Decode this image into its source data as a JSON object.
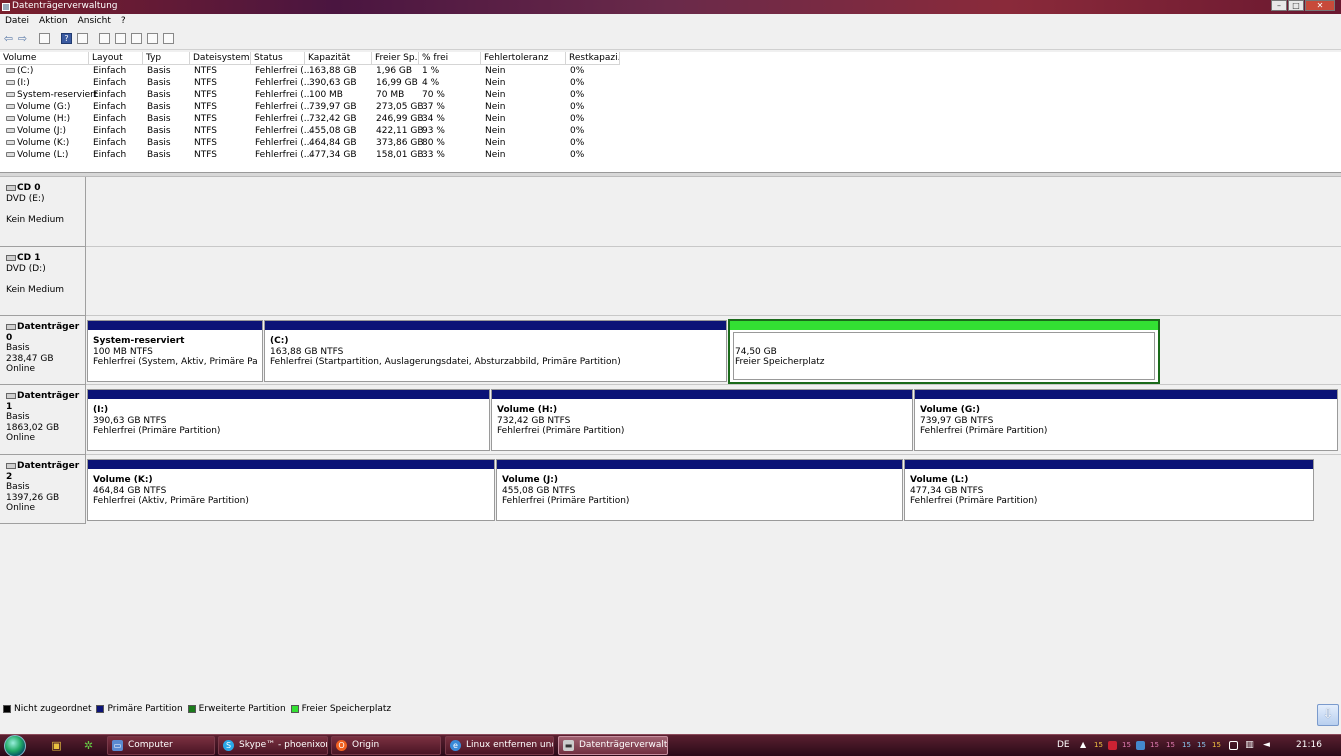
{
  "window": {
    "title": "Datenträgerverwaltung",
    "min_label": "–",
    "max_label": "□",
    "close_label": "✕"
  },
  "menu": [
    "Datei",
    "Aktion",
    "Ansicht",
    "?"
  ],
  "toolbar": {
    "back_label": "⇦",
    "forward_label": "⇨",
    "help_label": "?"
  },
  "volume_list": {
    "columns": [
      "Volume",
      "Layout",
      "Typ",
      "Dateisystem",
      "Status",
      "Kapazität",
      "Freier Sp...",
      "% frei",
      "Fehlertoleranz",
      "Restkapazi..."
    ],
    "rows": [
      [
        "(C:)",
        "Einfach",
        "Basis",
        "NTFS",
        "Fehlerfrei (...",
        "163,88 GB",
        "1,96 GB",
        "1 %",
        "Nein",
        "0%"
      ],
      [
        "(I:)",
        "Einfach",
        "Basis",
        "NTFS",
        "Fehlerfrei (...",
        "390,63 GB",
        "16,99 GB",
        "4 %",
        "Nein",
        "0%"
      ],
      [
        "System-reserviert",
        "Einfach",
        "Basis",
        "NTFS",
        "Fehlerfrei (...",
        "100 MB",
        "70 MB",
        "70 %",
        "Nein",
        "0%"
      ],
      [
        "Volume (G:)",
        "Einfach",
        "Basis",
        "NTFS",
        "Fehlerfrei (...",
        "739,97 GB",
        "273,05 GB",
        "37 %",
        "Nein",
        "0%"
      ],
      [
        "Volume (H:)",
        "Einfach",
        "Basis",
        "NTFS",
        "Fehlerfrei (...",
        "732,42 GB",
        "246,99 GB",
        "34 %",
        "Nein",
        "0%"
      ],
      [
        "Volume (J:)",
        "Einfach",
        "Basis",
        "NTFS",
        "Fehlerfrei (...",
        "455,08 GB",
        "422,11 GB",
        "93 %",
        "Nein",
        "0%"
      ],
      [
        "Volume (K:)",
        "Einfach",
        "Basis",
        "NTFS",
        "Fehlerfrei (...",
        "464,84 GB",
        "373,86 GB",
        "80 %",
        "Nein",
        "0%"
      ],
      [
        "Volume (L:)",
        "Einfach",
        "Basis",
        "NTFS",
        "Fehlerfrei (...",
        "477,34 GB",
        "158,01 GB",
        "33 %",
        "Nein",
        "0%"
      ]
    ]
  },
  "disks": [
    {
      "name": "CD 0",
      "line2": "DVD (E:)",
      "line3": "",
      "line4": "Kein Medium",
      "partitions": []
    },
    {
      "name": "CD 1",
      "line2": "DVD (D:)",
      "line3": "",
      "line4": "Kein Medium",
      "partitions": []
    },
    {
      "name": "Datenträger 0",
      "line2": "Basis",
      "line3": "238,47 GB",
      "line4": "Online",
      "partitions": [
        {
          "name": "System-reserviert",
          "size": "100 MB NTFS",
          "status": "Fehlerfrei (System, Aktiv, Primäre Partition)"
        },
        {
          "name": "(C:)",
          "size": "163,88 GB NTFS",
          "status": "Fehlerfrei (Startpartition, Auslagerungsdatei, Absturzabbild, Primäre Partition)"
        },
        {
          "name": "",
          "size": "74,50 GB",
          "status": "Freier Speicherplatz"
        }
      ]
    },
    {
      "name": "Datenträger 1",
      "line2": "Basis",
      "line3": "1863,02 GB",
      "line4": "Online",
      "partitions": [
        {
          "name": "(I:)",
          "size": "390,63 GB NTFS",
          "status": "Fehlerfrei (Primäre Partition)"
        },
        {
          "name": "Volume  (H:)",
          "size": "732,42 GB NTFS",
          "status": "Fehlerfrei (Primäre Partition)"
        },
        {
          "name": "Volume  (G:)",
          "size": "739,97 GB NTFS",
          "status": "Fehlerfrei (Primäre Partition)"
        }
      ]
    },
    {
      "name": "Datenträger 2",
      "line2": "Basis",
      "line3": "1397,26 GB",
      "line4": "Online",
      "partitions": [
        {
          "name": "Volume  (K:)",
          "size": "464,84 GB NTFS",
          "status": "Fehlerfrei (Aktiv, Primäre Partition)"
        },
        {
          "name": "Volume  (J:)",
          "size": "455,08 GB NTFS",
          "status": "Fehlerfrei (Primäre Partition)"
        },
        {
          "name": "Volume  (L:)",
          "size": "477,34 GB NTFS",
          "status": "Fehlerfrei (Primäre Partition)"
        }
      ]
    }
  ],
  "legend": [
    {
      "label": "Nicht zugeordnet",
      "color": "#000000"
    },
    {
      "label": "Primäre Partition",
      "color": "#0b1377"
    },
    {
      "label": "Erweiterte Partition",
      "color": "#1a7a1a"
    },
    {
      "label": "Freier Speicherplatz",
      "color": "#33e033"
    }
  ],
  "scroll_down_label": "⇩",
  "taskbar": {
    "buttons": [
      {
        "label": "Computer",
        "icon": "computer-icon"
      },
      {
        "label": "Skype™ - phoenixont...",
        "icon": "skype-icon"
      },
      {
        "label": "Origin",
        "icon": "origin-icon"
      },
      {
        "label": "Linux entfernen und ...",
        "icon": "browser-icon"
      },
      {
        "label": "Datenträgerverwaltu...",
        "icon": "disk-management-icon"
      }
    ],
    "lang": "DE",
    "tray_counts": [
      "15",
      "15",
      "15",
      "15",
      "15",
      "15",
      "15"
    ],
    "clock": "21:16"
  }
}
